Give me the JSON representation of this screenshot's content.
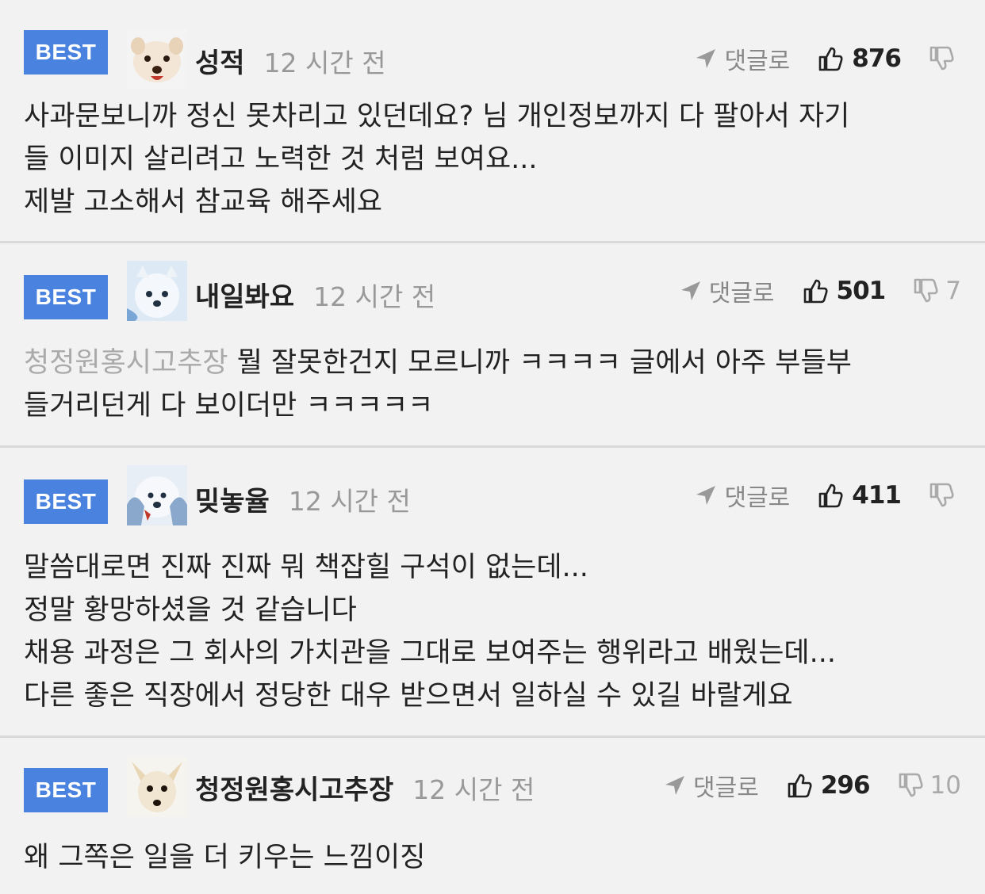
{
  "comments": [
    {
      "badge": "BEST",
      "username": "성적",
      "time": "12 시간 전",
      "reply_label": "댓글로",
      "likes": "876",
      "dislikes": "",
      "mention": "",
      "lines": [
        "사과문보니까 정신 못차리고 있던데요? 님 개인정보까지 다 팔아서 자기",
        "들 이미지 살리려고 노력한 것 처럼 보여요...",
        "제발 고소해서 참교육 해주세요"
      ]
    },
    {
      "badge": "BEST",
      "username": "내일봐요",
      "time": "12 시간 전",
      "reply_label": "댓글로",
      "likes": "501",
      "dislikes": "7",
      "mention": "청정원홍시고추장",
      "lines": [
        " 뭘 잘못한건지 모르니까 ㅋㅋㅋㅋ 글에서 아주 부들부",
        "들거리던게 다 보이더만 ㅋㅋㅋㅋㅋ"
      ]
    },
    {
      "badge": "BEST",
      "username": "밎놓율",
      "time": "12 시간 전",
      "reply_label": "댓글로",
      "likes": "411",
      "dislikes": "",
      "mention": "",
      "lines": [
        "말씀대로면 진짜 진짜 뭐 책잡힐 구석이 없는데...",
        "정말 황망하셨을 것 같습니다",
        "채용 과정은 그 회사의 가치관을 그대로 보여주는 행위라고 배웠는데...",
        "다른 좋은 직장에서 정당한 대우 받으면서 일하실 수 있길 바랄게요"
      ]
    },
    {
      "badge": "BEST",
      "username": "청정원홍시고추장",
      "time": "12 시간 전",
      "reply_label": "댓글로",
      "likes": "296",
      "dislikes": "10",
      "mention": "",
      "lines": [
        "왜 그쪽은 일을 더 키우는 느낌이징"
      ]
    }
  ],
  "colors": {
    "badge": "#4a82e0",
    "background": "#f2f2f2",
    "divider": "#d9d9d9",
    "muted": "#999999"
  },
  "icons": [
    "reply-arrow-icon",
    "thumbs-up-icon",
    "thumbs-down-icon",
    "avatar-icon"
  ]
}
